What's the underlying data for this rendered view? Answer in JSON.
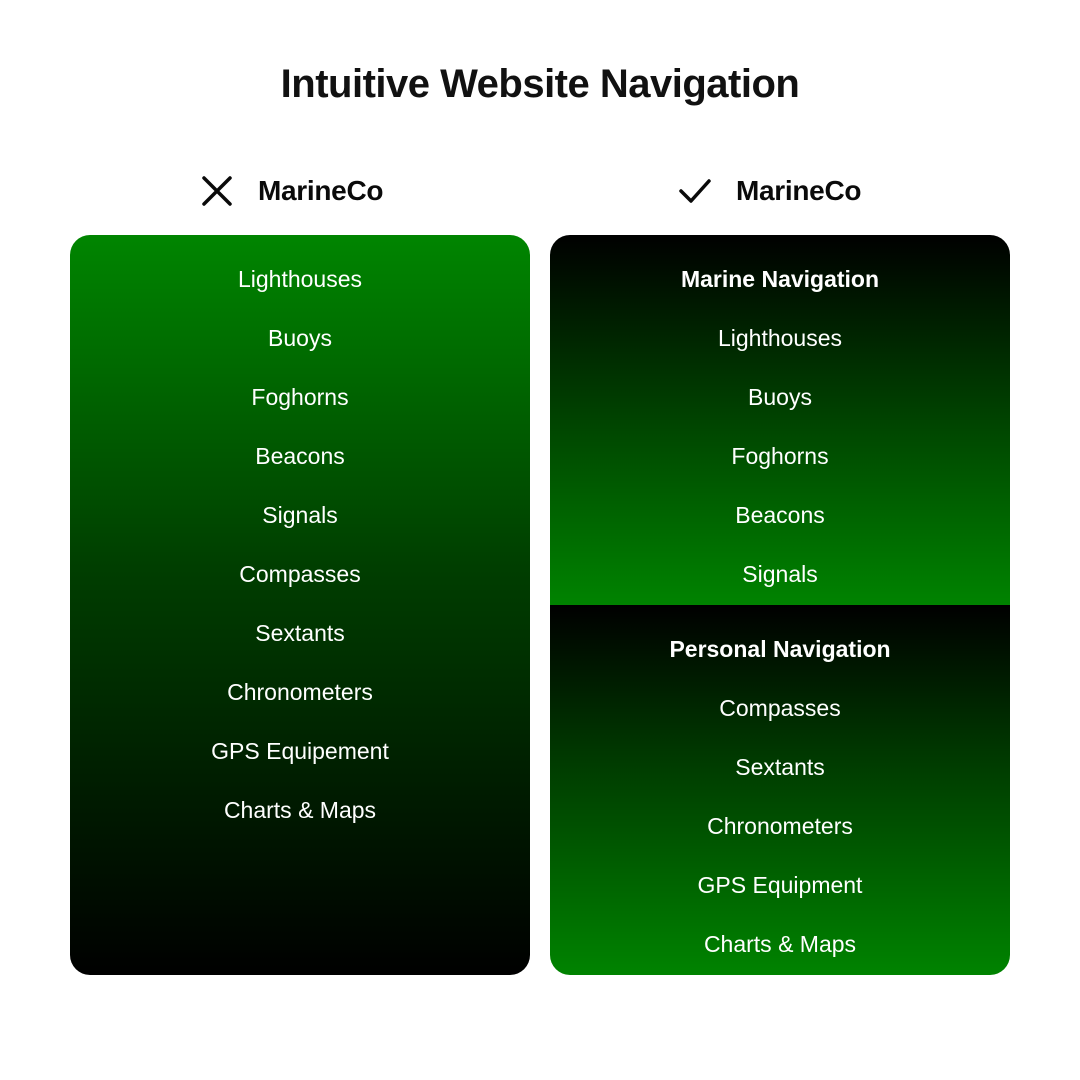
{
  "title": "Intuitive Website Navigation",
  "left_column": {
    "icon": "x-cross-icon",
    "brand": "MarineCo",
    "items": [
      "Lighthouses",
      "Buoys",
      "Foghorns",
      "Beacons",
      "Signals",
      "Compasses",
      "Sextants",
      "Chronometers",
      "GPS Equipement",
      "Charts & Maps"
    ]
  },
  "right_column": {
    "icon": "checkmark-icon",
    "brand": "MarineCo",
    "sections": [
      {
        "heading": "Marine Navigation",
        "items": [
          "Lighthouses",
          "Buoys",
          "Foghorns",
          "Beacons",
          "Signals"
        ]
      },
      {
        "heading": "Personal Navigation",
        "items": [
          "Compasses",
          "Sextants",
          "Chronometers",
          "GPS Equipment",
          "Charts & Maps"
        ]
      }
    ]
  },
  "colors": {
    "green": "#008300",
    "black": "#000000"
  }
}
